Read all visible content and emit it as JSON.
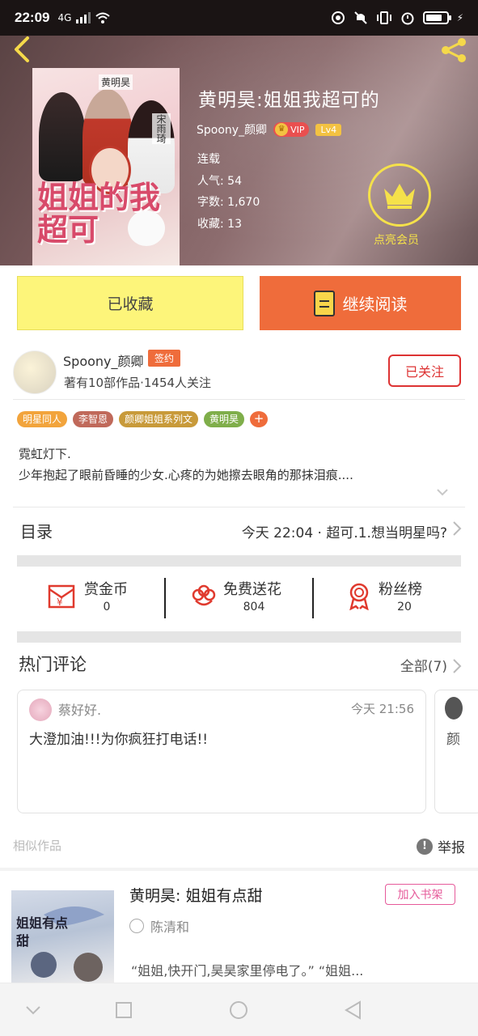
{
  "status_bar": {
    "time": "22:09",
    "network": "4G"
  },
  "book": {
    "title": "黄明昊:姐姐我超可的",
    "author": "Spoony_颜卿",
    "vip": "VIP",
    "level": "Lv4",
    "status": "连载",
    "popularity_label": "人气:",
    "popularity": "54",
    "word_count_label": "字数:",
    "word_count": "1,670",
    "collect_label": "收藏:",
    "collect_count": "13",
    "cover_text": "姐姐的我超可",
    "cover_names": [
      "黄明昊",
      "宋雨琦"
    ]
  },
  "member": {
    "label": "点亮会员"
  },
  "actions": {
    "collected": "已收藏",
    "continue_reading": "继续阅读"
  },
  "author_card": {
    "name": "Spoony_颜卿",
    "sign_badge": "签约",
    "stats": "著有10部作品·1454人关注",
    "follow": "已关注"
  },
  "tags": [
    {
      "label": "明星同人",
      "color": "#f2a43c"
    },
    {
      "label": "李智恩",
      "color": "#c0695a"
    },
    {
      "label": "颜卿姐姐系列文",
      "color": "#c89a3a"
    },
    {
      "label": "黄明昊",
      "color": "#7fae4a"
    }
  ],
  "tag_add": "+",
  "summary": {
    "line1": "霓虹灯下.",
    "line2": "少年抱起了眼前昏睡的少女.心疼的为她擦去眼角的那抹泪痕...."
  },
  "catalog": {
    "label": "目录",
    "latest": "今天 22:04 · 超可.1.想当明星吗?"
  },
  "rewards": [
    {
      "label": "赏金币",
      "value": "0",
      "icon": "red-envelope-icon"
    },
    {
      "label": "免费送花",
      "value": "804",
      "icon": "flower-icon"
    },
    {
      "label": "粉丝榜",
      "value": "20",
      "icon": "medal-icon"
    }
  ],
  "comments": {
    "title": "热门评论",
    "all": "全部(7)",
    "items": [
      {
        "user": "蔡好好.",
        "time": "今天 21:56",
        "text": "大澄加油!!!为你疯狂打电话!!"
      },
      {
        "user": "",
        "time": "",
        "text": "颜"
      }
    ]
  },
  "similar": {
    "label": "相似作品",
    "report": "举报",
    "items": [
      {
        "title": "黄明昊: 姐姐有点甜",
        "author": "陈清和",
        "add_shelf": "加入书架",
        "desc": "“姐姐,快开门,昊昊家里停电了。” “姐姐...",
        "cover_text": "姐姐有点甜"
      }
    ]
  },
  "colors": {
    "accent_orange": "#ef6c3b",
    "accent_yellow": "#fdf57a",
    "gold": "#f5e14a",
    "red": "#dd3333"
  }
}
